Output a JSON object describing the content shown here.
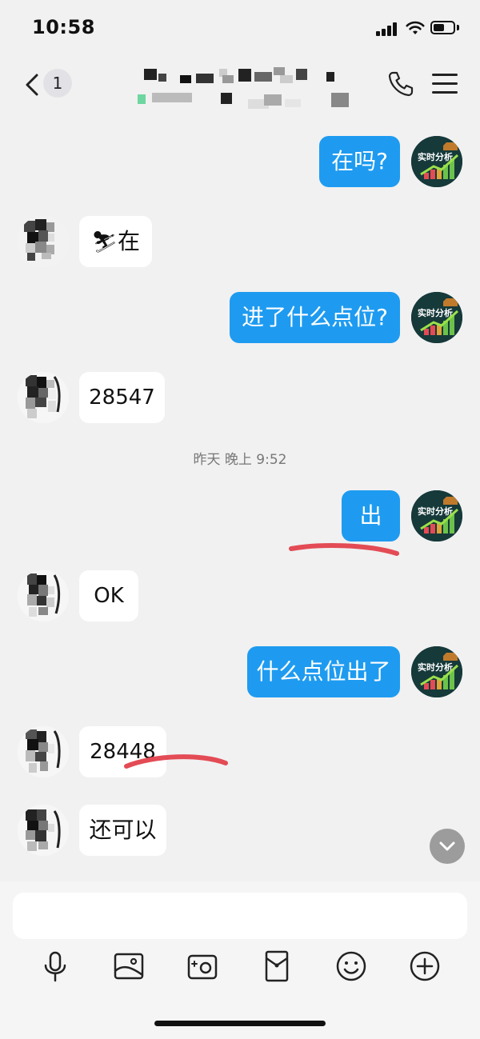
{
  "status_bar": {
    "time": "10:58"
  },
  "nav": {
    "unread_count": "1"
  },
  "messages": [
    {
      "side": "out",
      "text": "在吗?"
    },
    {
      "side": "in",
      "emoji": "⛷",
      "text": "在"
    },
    {
      "side": "out",
      "text": "进了什么点位?"
    },
    {
      "side": "in",
      "text": "28547"
    },
    {
      "side": "out",
      "text": "出"
    },
    {
      "side": "in",
      "text": "OK"
    },
    {
      "side": "out",
      "text": "什么点位出了"
    },
    {
      "side": "in",
      "text": "28448"
    },
    {
      "side": "in",
      "text": "还可以"
    }
  ],
  "timestamp": "昨天 晚上 9:52",
  "my_avatar": {
    "text": "实时分析"
  },
  "input": {
    "placeholder": ""
  },
  "toolbar": [
    "microphone-icon",
    "image-icon",
    "camera-icon",
    "red-packet-icon",
    "emoji-icon",
    "plus-icon"
  ],
  "colors": {
    "outgoing_bubble": "#1e9bf0",
    "incoming_bubble": "#ffffff",
    "background": "#f1f1f1",
    "annotation_underline": "#e34b55"
  }
}
